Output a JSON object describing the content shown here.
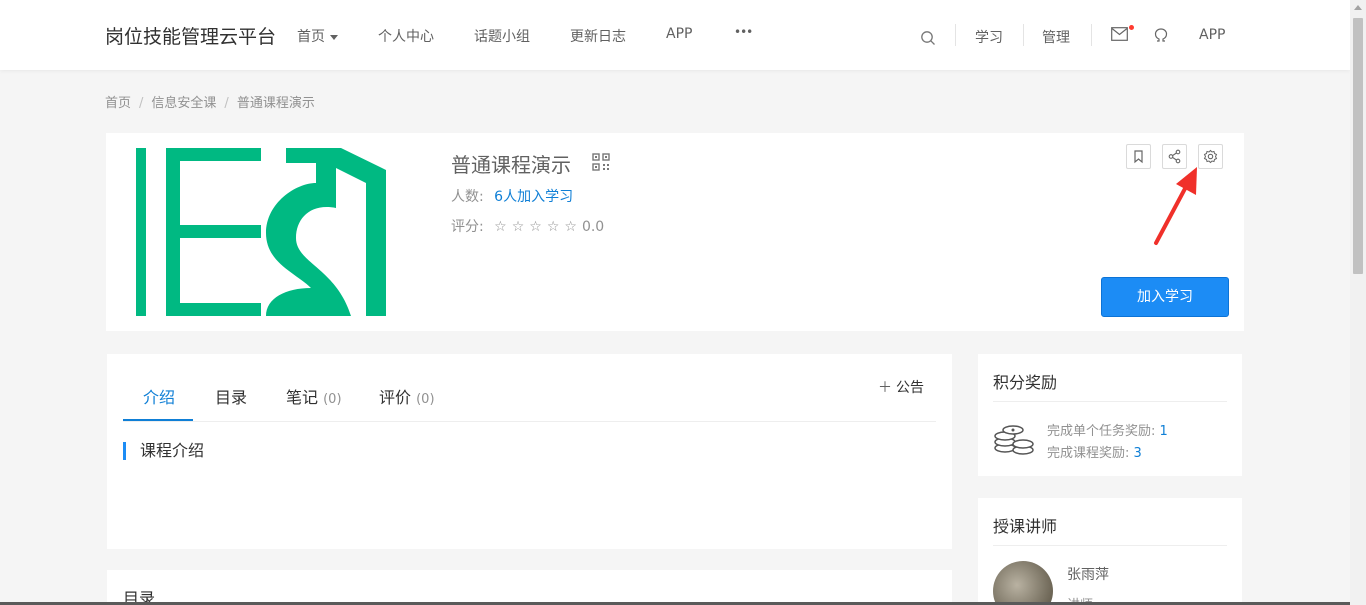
{
  "header": {
    "logo": "岗位技能管理云平台",
    "nav": [
      {
        "label": "首页"
      },
      {
        "label": "个人中心"
      },
      {
        "label": "话题小组"
      },
      {
        "label": "更新日志"
      },
      {
        "label": "APP"
      },
      {
        "label": "•••"
      }
    ],
    "right": {
      "study": "学习",
      "manage": "管理",
      "app": "APP"
    }
  },
  "breadcrumb": [
    "首页",
    "信息安全课",
    "普通课程演示"
  ],
  "course": {
    "title": "普通课程演示",
    "students_label": "人数:",
    "students_count": "6",
    "students_suffix": "人加入学习",
    "rating_label": "评分:",
    "stars": "☆☆☆☆☆",
    "rating_value": "0.0",
    "join_label": "加入学习",
    "accent_color": "#1c8cf5",
    "logo_color": "#00b982"
  },
  "tabs": [
    {
      "label": "介绍",
      "count": ""
    },
    {
      "label": "目录",
      "count": ""
    },
    {
      "label": "笔记",
      "count": "(0)"
    },
    {
      "label": "评价",
      "count": "(0)"
    }
  ],
  "notice": {
    "label": "公告"
  },
  "intro": {
    "section_title": "课程介绍"
  },
  "catalog": {
    "title": "目录"
  },
  "rewards": {
    "title": "积分奖励",
    "single_task_label": "完成单个任务奖励:",
    "single_task_value": "1",
    "course_label": "完成课程奖励:",
    "course_value": "3"
  },
  "teacher": {
    "title": "授课讲师",
    "name": "张雨萍",
    "subtitle": "讲师"
  }
}
